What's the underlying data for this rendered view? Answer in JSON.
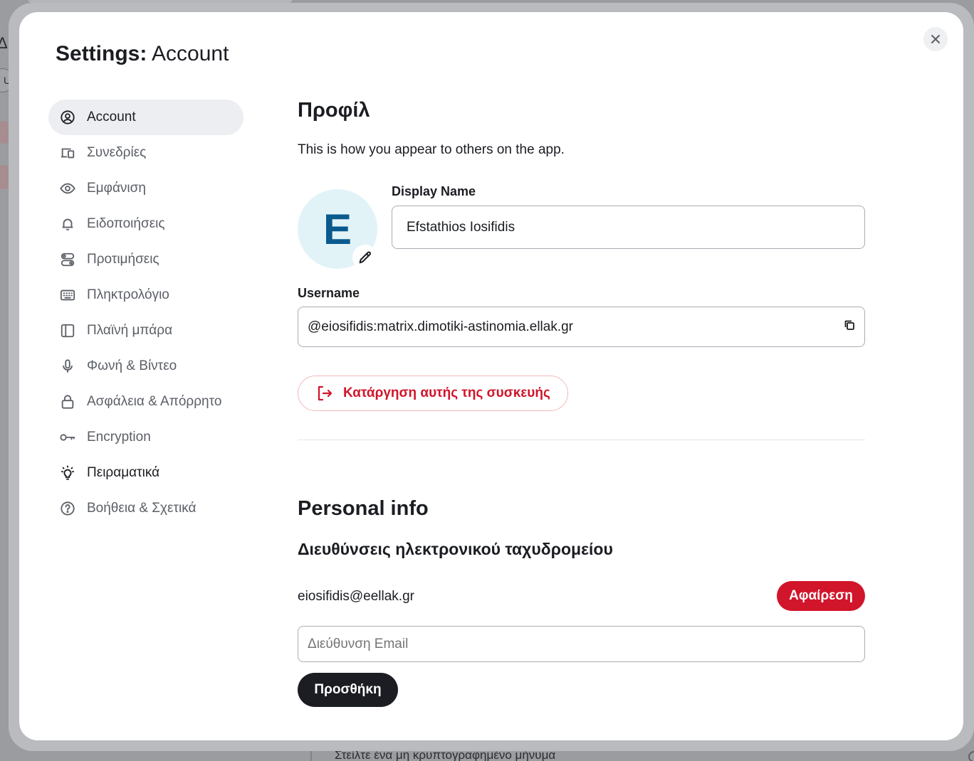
{
  "background": {
    "left_fragment": "Δl",
    "pill_letter": "U",
    "bottom_message": "Στείλτε ένα μη κρυπτογραφημένο μήνυμα"
  },
  "dialog": {
    "title_prefix": "Settings:",
    "title_section": "Account",
    "close_icon": "close-icon"
  },
  "sidebar": {
    "items": [
      {
        "label": "Account",
        "icon": "user-circle-icon",
        "active": true
      },
      {
        "label": "Συνεδρίες",
        "icon": "devices-icon"
      },
      {
        "label": "Εμφάνιση",
        "icon": "eye-icon"
      },
      {
        "label": "Ειδοποιήσεις",
        "icon": "bell-icon"
      },
      {
        "label": "Προτιμήσεις",
        "icon": "preferences-icon"
      },
      {
        "label": "Πληκτρολόγιο",
        "icon": "keyboard-icon"
      },
      {
        "label": "Πλαϊνή μπάρα",
        "icon": "sidebar-icon"
      },
      {
        "label": "Φωνή & Βίντεο",
        "icon": "microphone-icon"
      },
      {
        "label": "Ασφάλεια & Απόρρητο",
        "icon": "lock-icon"
      },
      {
        "label": "Encryption",
        "icon": "key-icon"
      },
      {
        "label": "Πειραματικά",
        "icon": "lightbulb-icon"
      },
      {
        "label": "Βοήθεια & Σχετικά",
        "icon": "help-icon"
      }
    ]
  },
  "profile": {
    "heading": "Προφίλ",
    "subtitle": "This is how you appear to others on the app.",
    "avatar_letter": "E",
    "display_name_label": "Display Name",
    "display_name_value": "Efstathios Iosifidis",
    "username_label": "Username",
    "username_value": "@eiosifidis:matrix.dimotiki-astinomia.ellak.gr",
    "signout_label": "Κατάργηση αυτής της συσκευής"
  },
  "personal_info": {
    "heading": "Personal info",
    "emails_heading": "Διευθύνσεις ηλεκτρονικού ταχυδρομείου",
    "email": "eiosifidis@eellak.gr",
    "remove_label": "Αφαίρεση",
    "email_placeholder": "Διεύθυνση Email",
    "add_label": "Προσθήκη"
  },
  "colors": {
    "accent_red": "#d1152a",
    "primary_dark": "#1b1d22",
    "avatar_bg": "#e2f3f8",
    "avatar_fg": "#0a5a8e"
  }
}
